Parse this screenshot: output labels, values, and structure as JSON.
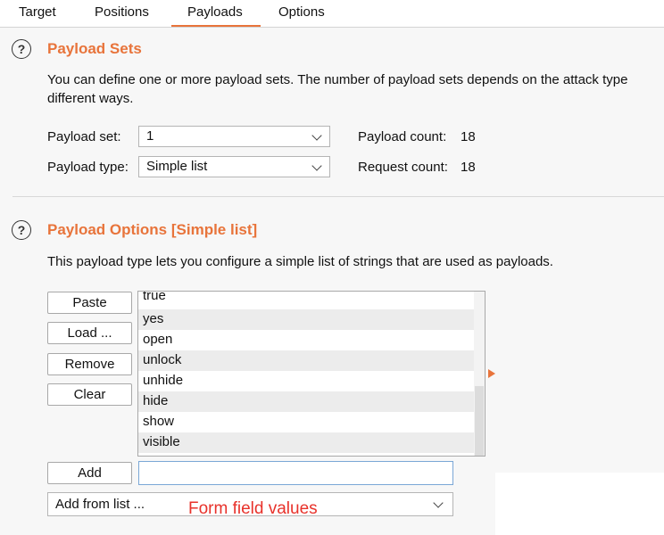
{
  "tabs": [
    "Target",
    "Positions",
    "Payloads",
    "Options"
  ],
  "payload_sets": {
    "help_glyph": "?",
    "title": "Payload Sets",
    "description_line1": "You can define one or more payload sets. The number of payload sets depends on the attack type",
    "description_line2": "different ways.",
    "payload_set_label": "Payload set:",
    "payload_set_value": "1",
    "payload_type_label": "Payload type:",
    "payload_type_value": "Simple list",
    "payload_count_label": "Payload count:",
    "payload_count_value": "18",
    "request_count_label": "Request count:",
    "request_count_value": "18"
  },
  "payload_options": {
    "help_glyph": "?",
    "title": "Payload Options [Simple list]",
    "description": "This payload type lets you configure a simple list of strings that are used as payloads.",
    "buttons": {
      "paste": "Paste",
      "load": "Load ...",
      "remove": "Remove",
      "clear": "Clear",
      "add": "Add"
    },
    "list_items": [
      "true",
      "yes",
      "open",
      "unlock",
      "unhide",
      "hide",
      "show",
      "visible"
    ],
    "add_input_value": "",
    "add_from_list": "Add from list ..."
  },
  "annotation": "Form field values",
  "colors": {
    "accent": "#e8743b",
    "annotation": "#e8322b"
  }
}
